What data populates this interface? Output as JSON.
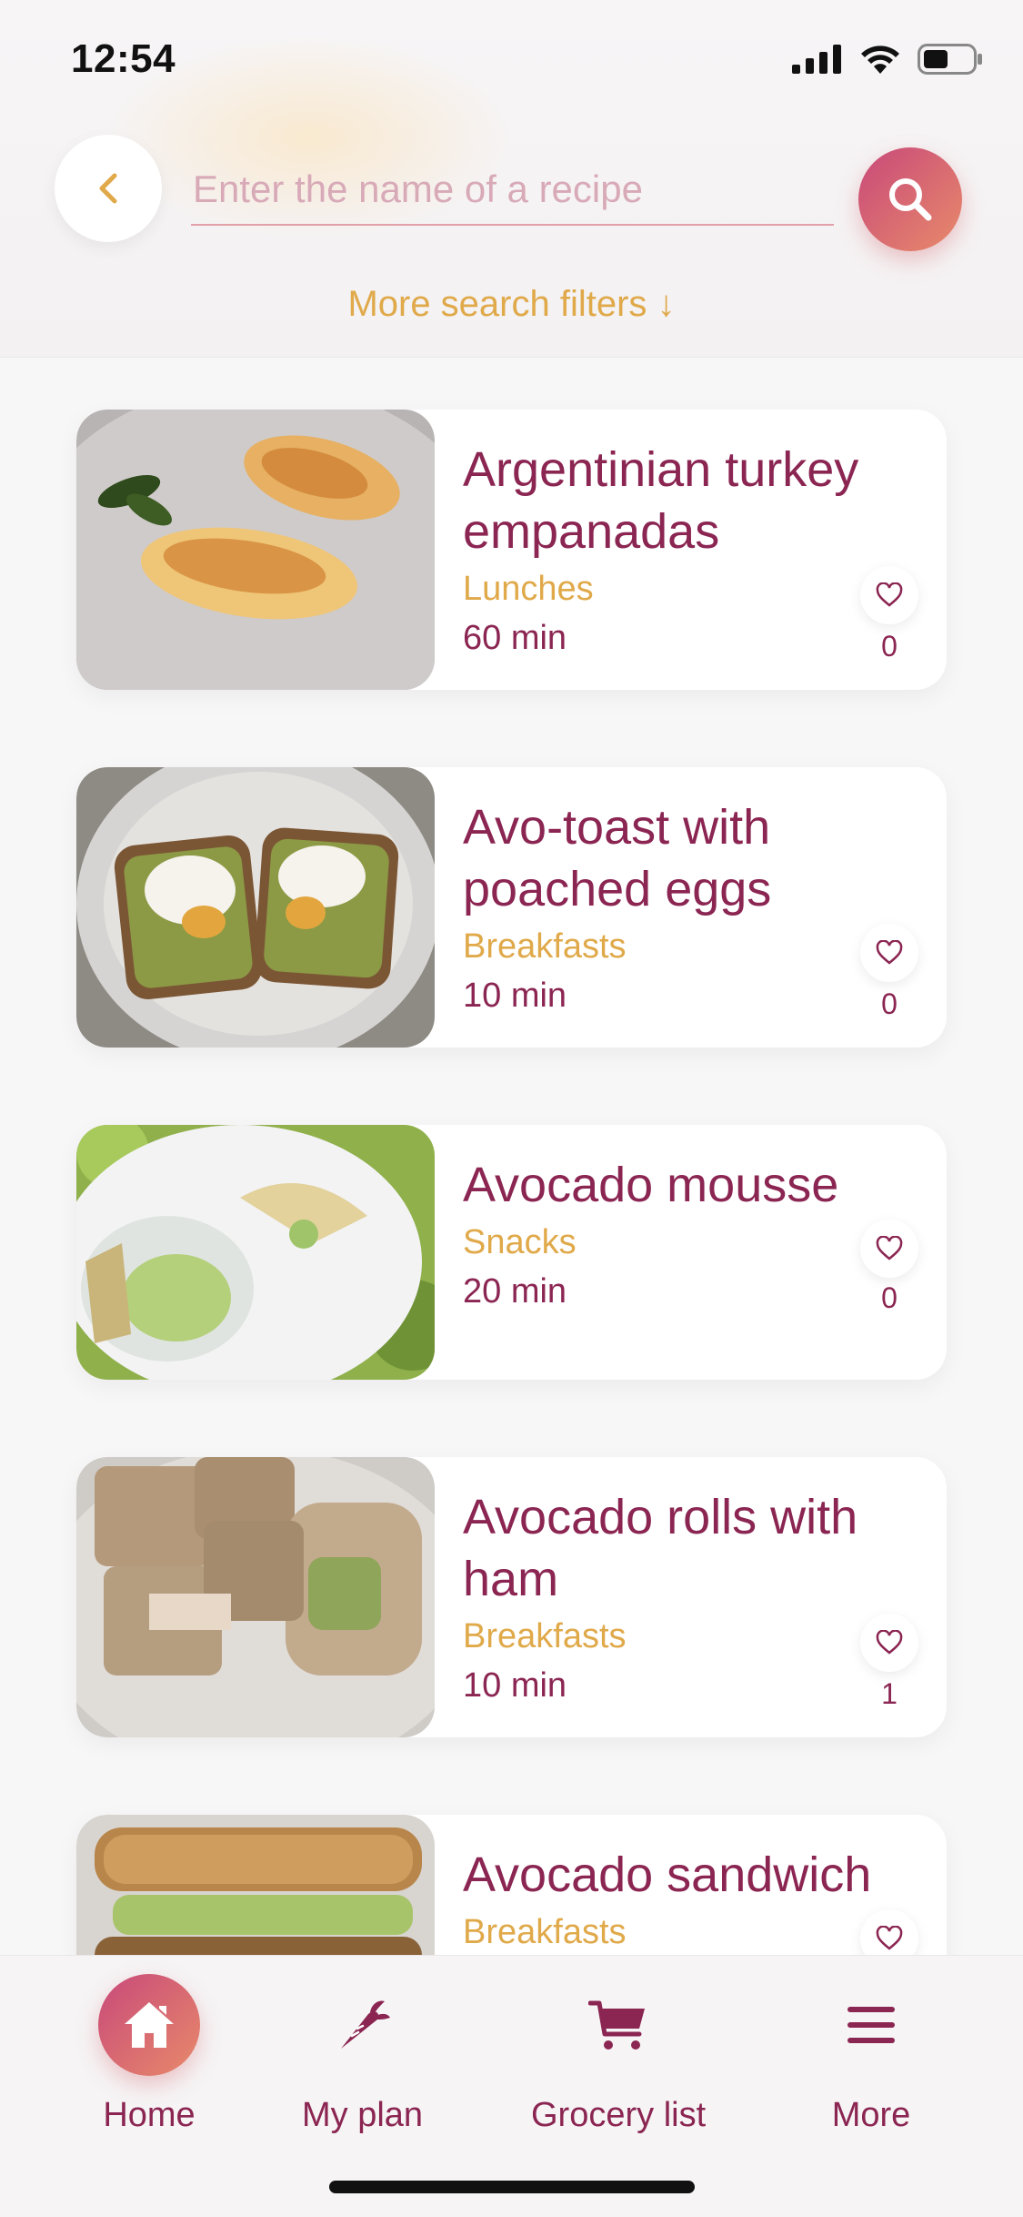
{
  "status_bar": {
    "time": "12:54"
  },
  "search": {
    "placeholder": "Enter the name of a recipe",
    "value": "",
    "more_filters_label": "More search filters ↓"
  },
  "recipes": [
    {
      "title": "Argentinian turkey empanadas",
      "category": "Lunches",
      "time": "60 min",
      "likes": "0"
    },
    {
      "title": "Avo-toast with poached eggs",
      "category": "Breakfasts",
      "time": "10 min",
      "likes": "0"
    },
    {
      "title": "Avocado mousse",
      "category": "Snacks",
      "time": "20 min",
      "likes": "0"
    },
    {
      "title": "Avocado rolls with ham",
      "category": "Breakfasts",
      "time": "10 min",
      "likes": "1"
    },
    {
      "title": "Avocado sandwich",
      "category": "Breakfasts",
      "time": "",
      "likes": ""
    }
  ],
  "tabbar": {
    "items": [
      {
        "label": "Home",
        "icon": "home-icon",
        "active": true
      },
      {
        "label": "My plan",
        "icon": "carrot-icon",
        "active": false
      },
      {
        "label": "Grocery list",
        "icon": "cart-icon",
        "active": false
      },
      {
        "label": "More",
        "icon": "menu-icon",
        "active": false
      }
    ]
  },
  "colors": {
    "primary": "#8b2552",
    "accent": "#e0a94a",
    "gradient_start": "#c8497a",
    "gradient_end": "#e88a6a"
  }
}
